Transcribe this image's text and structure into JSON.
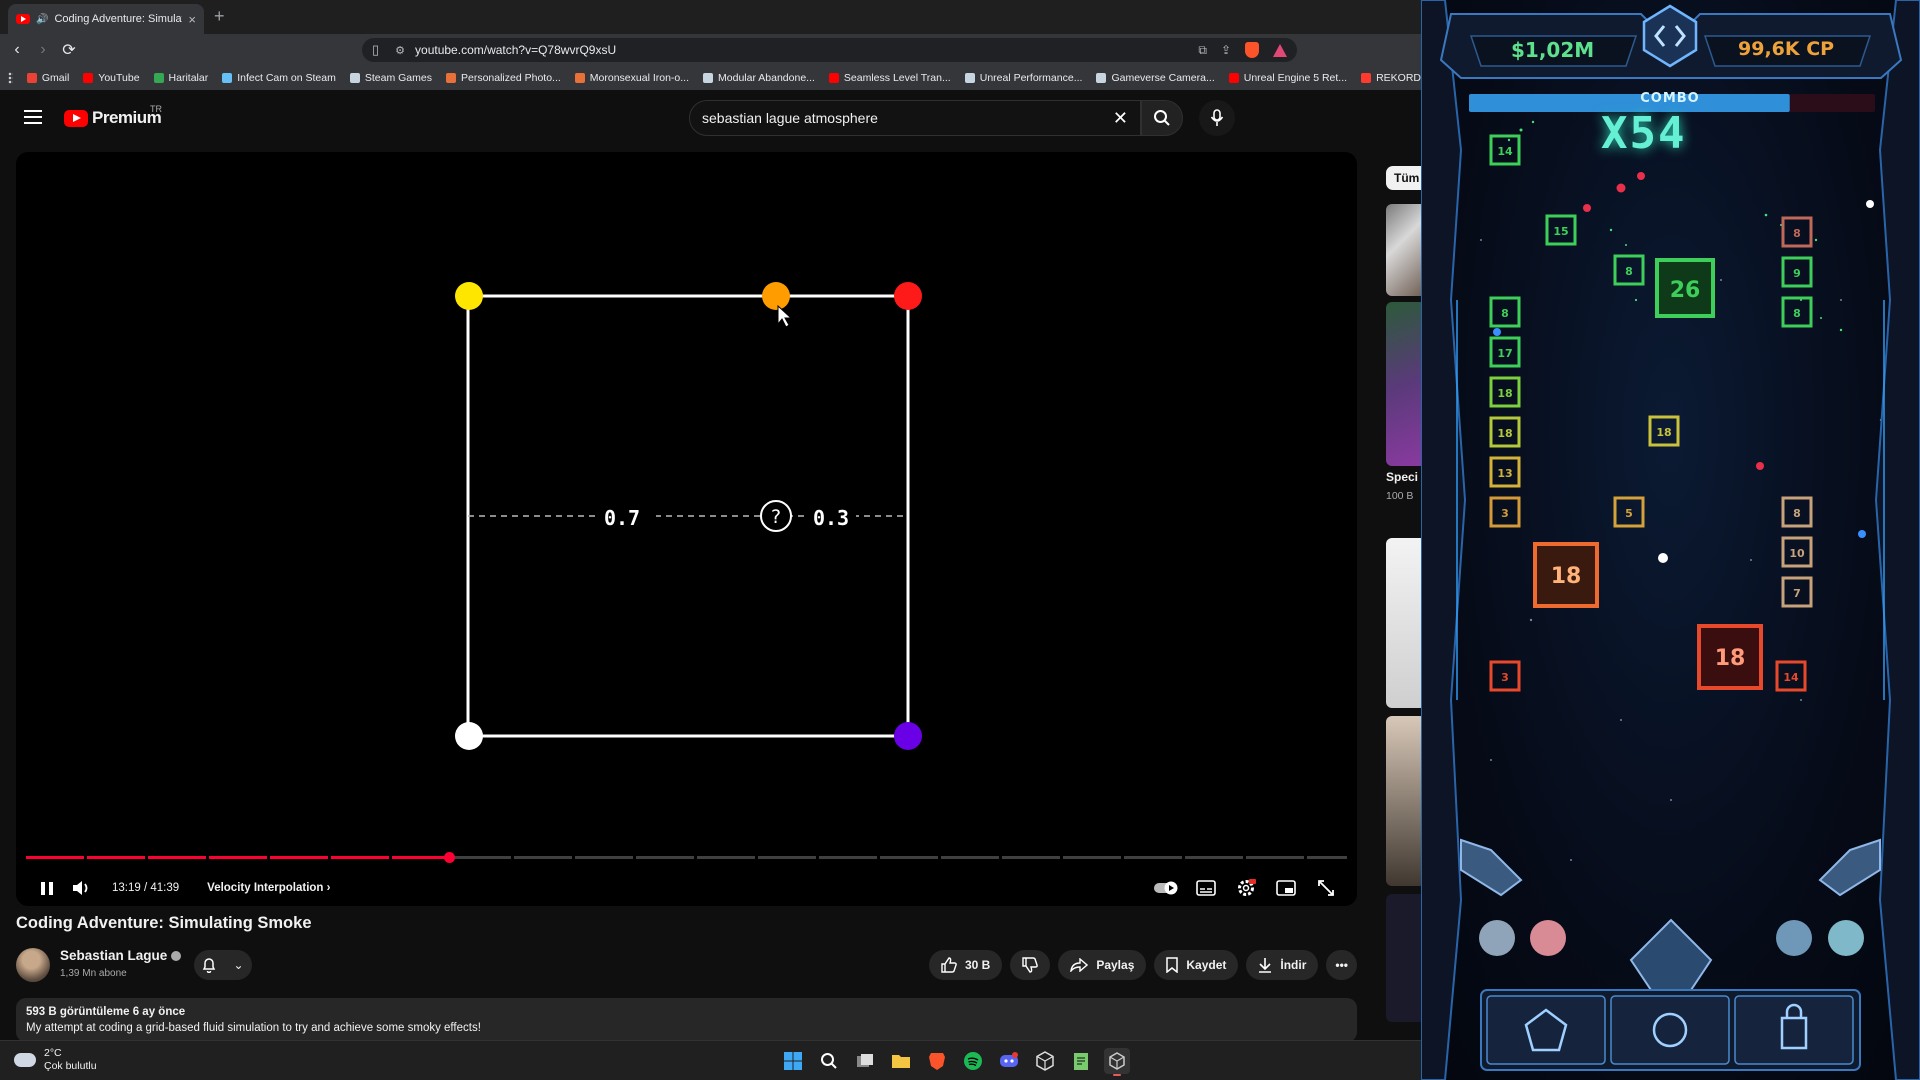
{
  "browser": {
    "tab_title": "Coding Adventure: Simulating Smoke",
    "tab_close": "×",
    "new_tab": "+",
    "url": "youtube.com/watch?v=Q78wvrQ9xsU",
    "bookmarks": [
      {
        "label": "Gmail",
        "color": "#ea4335"
      },
      {
        "label": "YouTube",
        "color": "#ff0000"
      },
      {
        "label": "Haritalar",
        "color": "#34a853"
      },
      {
        "label": "Infect Cam on Steam",
        "color": "#66c0f4"
      },
      {
        "label": "Steam Games",
        "color": "#c7d5e0"
      },
      {
        "label": "Personalized Photo...",
        "color": "#e8713a"
      },
      {
        "label": "Moronsexual Iron-o...",
        "color": "#e8713a"
      },
      {
        "label": "Modular Abandone...",
        "color": "#c7d5e0"
      },
      {
        "label": "Seamless Level Tran...",
        "color": "#ff0000"
      },
      {
        "label": "Unreal Performance...",
        "color": "#c7d5e0"
      },
      {
        "label": "Gameverse Camera...",
        "color": "#c7d5e0"
      },
      {
        "label": "Unreal Engine 5 Ret...",
        "color": "#ff0000"
      },
      {
        "label": "REKORD",
        "color": "#ff3b30"
      }
    ]
  },
  "youtube": {
    "brand": "Premium",
    "country": "TR",
    "search_query": "sebastian lague atmosphere",
    "clear_glyph": "✕",
    "video": {
      "time": "13:19 / 41:39",
      "chapter": "Velocity Interpolation",
      "progress_fraction": 0.32,
      "diagram": {
        "left_value": "0.7",
        "right_value": "0.3",
        "center_label": "?"
      }
    },
    "meta": {
      "title": "Coding Adventure: Simulating Smoke",
      "channel": "Sebastian Lague",
      "subscribers": "1,39 Mn abone",
      "likes": "30 B",
      "share": "Paylaş",
      "save": "Kaydet",
      "download": "İndir",
      "views_date": "593 B görüntüleme  6 ay önce",
      "description": "My attempt at coding a grid-based fluid simulation to try and achieve some smoky effects!"
    },
    "sidebar": {
      "chip": "Tüm",
      "rec_title": "Speci",
      "rec_views": "100 B"
    }
  },
  "taskbar": {
    "temperature": "2°C",
    "condition": "Çok bulutlu"
  },
  "game": {
    "money": "$1,02M",
    "cp": "99,6K CP",
    "combo_label": "COMBO",
    "combo_multiplier": "X54",
    "combo_fill_fraction": 0.79,
    "blocks": [
      {
        "value": "14",
        "color": "#3ecf5a"
      },
      {
        "value": "15",
        "color": "#3ecf5a"
      },
      {
        "value": "8",
        "color": "#3ecf5a"
      },
      {
        "value": "26",
        "color": "#3ecf5a"
      },
      {
        "value": "8",
        "color": "#3ecf5a"
      },
      {
        "value": "17",
        "color": "#3ecf5a"
      },
      {
        "value": "18",
        "color": "#7ccf3e"
      },
      {
        "value": "18",
        "color": "#b5c73a"
      },
      {
        "value": "13",
        "color": "#d4b23a"
      },
      {
        "value": "3",
        "color": "#d49a3a"
      },
      {
        "value": "18",
        "color": "#c9c23a"
      },
      {
        "value": "5",
        "color": "#d4a13a"
      },
      {
        "value": "8",
        "color": "#c0685a"
      },
      {
        "value": "9",
        "color": "#3ecf5a"
      },
      {
        "value": "8",
        "color": "#3ecf5a"
      },
      {
        "value": "8",
        "color": "#c8a27a"
      },
      {
        "value": "10",
        "color": "#c8a27a"
      },
      {
        "value": "7",
        "color": "#c8a27a"
      },
      {
        "value": "18",
        "color": "#ef6a2f"
      },
      {
        "value": "18",
        "color": "#e8492a"
      },
      {
        "value": "3",
        "color": "#e8492a"
      },
      {
        "value": "14",
        "color": "#e8492a"
      }
    ]
  }
}
